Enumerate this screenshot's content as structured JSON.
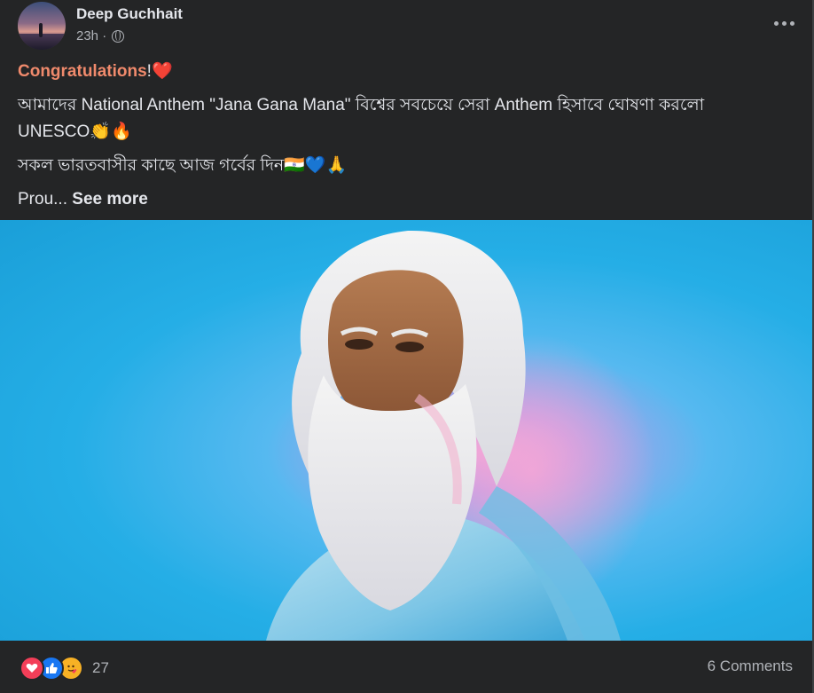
{
  "post": {
    "author": "Deep Guchhait",
    "timestamp": "23h ·",
    "audience_icon": "globe-icon",
    "text": {
      "greeting": "Congratulations",
      "greeting_suffix": "!❤️",
      "line2": "আমাদের National Anthem \"Jana Gana Mana\" বিশ্বের সবচেয়ে সেরা Anthem হিসাবে ঘোষণা করলো UNESCO👏🔥",
      "line3": "সকল ভারতবাসীর কাছে আজ গর্বের দিন🇮🇳💙🙏",
      "truncated": "Prou...",
      "see_more": "See more"
    }
  },
  "footer": {
    "reaction_icons": [
      "love-icon",
      "like-icon",
      "care-icon"
    ],
    "reaction_count": "27",
    "comments": "6 Comments"
  },
  "colors": {
    "background": "#242526",
    "highlight": "#f08a6c",
    "photo_background": "#25aee6"
  }
}
